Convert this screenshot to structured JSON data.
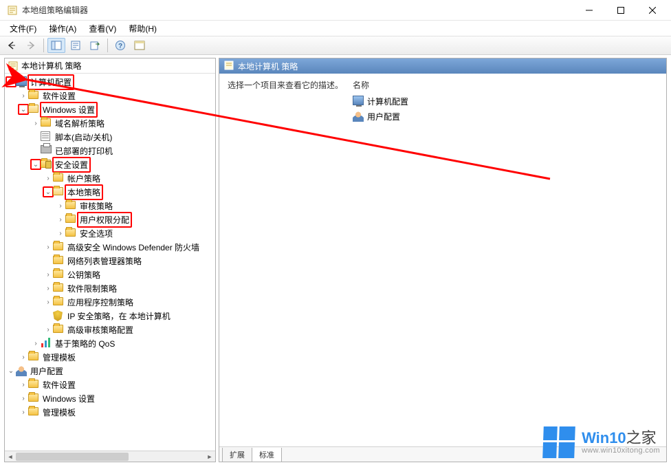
{
  "window": {
    "title": "本地组策略编辑器"
  },
  "menu": {
    "file": "文件(F)",
    "action": "操作(A)",
    "view": "查看(V)",
    "help": "帮助(H)"
  },
  "tree": {
    "root": "本地计算机 策略",
    "computer_config": "计算机配置",
    "software_settings": "软件设置",
    "windows_settings": "Windows 设置",
    "dns_policy": "域名解析策略",
    "scripts": "脚本(启动/关机)",
    "deployed_printers": "已部署的打印机",
    "security_settings": "安全设置",
    "account_policies": "帐户策略",
    "local_policies": "本地策略",
    "audit_policy": "审核策略",
    "user_rights": "用户权限分配",
    "security_options": "安全选项",
    "defender_firewall": "高级安全 Windows Defender 防火墙",
    "network_list": "网络列表管理器策略",
    "public_key": "公钥策略",
    "software_restriction": "软件限制策略",
    "app_control": "应用程序控制策略",
    "ip_security": "IP 安全策略，在 本地计算机",
    "advanced_audit": "高级审核策略配置",
    "policy_qos": "基于策略的 QoS",
    "admin_templates": "管理模板",
    "user_config": "用户配置",
    "u_software_settings": "软件设置",
    "u_windows_settings": "Windows 设置",
    "u_admin_templates": "管理模板"
  },
  "right": {
    "header": "本地计算机 策略",
    "description": "选择一个项目来查看它的描述。",
    "col_name": "名称",
    "items": {
      "computer": "计算机配置",
      "user": "用户配置"
    },
    "tabs": {
      "extended": "扩展",
      "standard": "标准"
    }
  },
  "watermark": {
    "brand_prefix": "Win10",
    "brand_suffix": "之家",
    "url": "www.win10xitong.com"
  }
}
